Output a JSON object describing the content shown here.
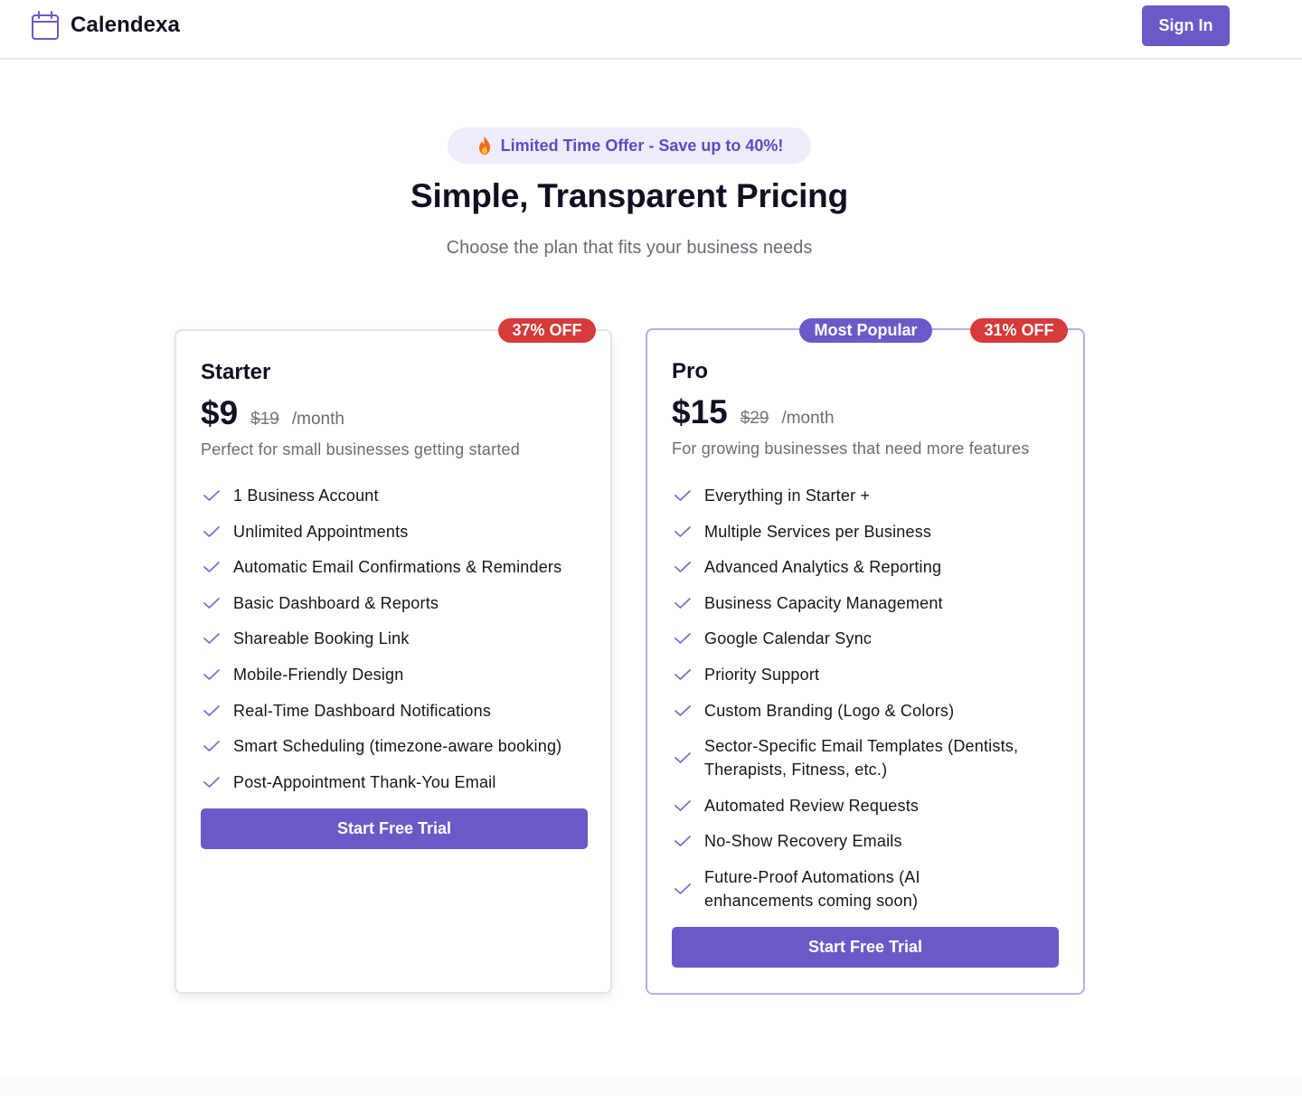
{
  "header": {
    "brand": "Calendexa",
    "signin_label": "Sign In"
  },
  "hero": {
    "offer": "Limited Time Offer - Save up to 40%!",
    "title": "Simple, Transparent Pricing",
    "subtitle": "Choose the plan that fits your business needs"
  },
  "plans": [
    {
      "name": "Starter",
      "price": "$9",
      "old_price": "$19",
      "period": "/month",
      "description": "Perfect for small businesses getting started",
      "discount_badge": "37% OFF",
      "features": [
        "1 Business Account",
        "Unlimited Appointments",
        "Automatic Email Confirmations & Reminders",
        "Basic Dashboard & Reports",
        "Shareable Booking Link",
        "Mobile-Friendly Design",
        "Real-Time Dashboard Notifications",
        "Smart Scheduling (timezone-aware booking)",
        "Post-Appointment Thank-You Email"
      ],
      "cta": "Start Free Trial"
    },
    {
      "name": "Pro",
      "price": "$15",
      "old_price": "$29",
      "period": "/month",
      "description": "For growing businesses that need more features",
      "popular_badge": "Most Popular",
      "discount_badge": "31% OFF",
      "features": [
        "Everything in Starter +",
        "Multiple Services per Business",
        "Advanced Analytics & Reporting",
        "Business Capacity Management",
        "Google Calendar Sync",
        "Priority Support",
        "Custom Branding (Logo & Colors)",
        "Sector-Specific Email Templates (Dentists, Therapists, Fitness, etc.)",
        "Automated Review Requests",
        "No-Show Recovery Emails",
        "Future-Proof Automations (AI enhancements coming soon)"
      ],
      "cta": "Start Free Trial"
    }
  ],
  "colors": {
    "accent": "#6a5ac8",
    "discount": "#d63a3a",
    "offer_bg": "#eeecf9",
    "pro_border": "#b5aee4"
  },
  "icons": [
    "calendar-icon",
    "flame-icon",
    "check-icon"
  ]
}
